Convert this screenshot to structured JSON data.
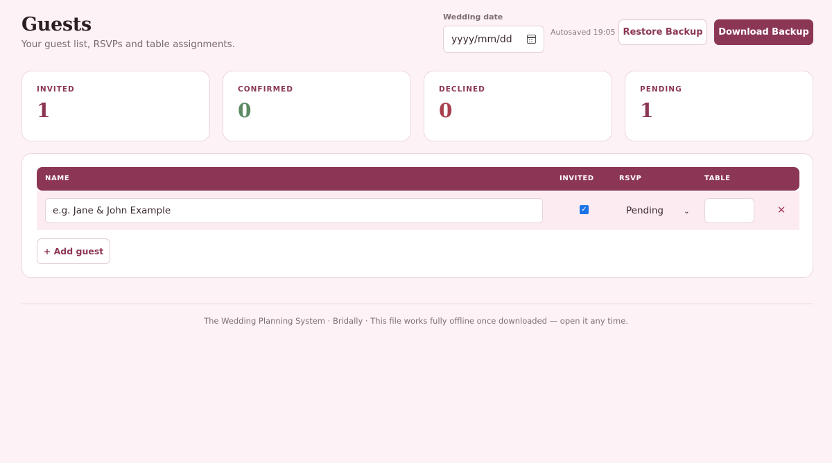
{
  "header": {
    "title": "Guests",
    "subtitle": "Your guest list, RSVPs and table assignments."
  },
  "wedding_date": {
    "label": "Wedding date",
    "placeholder": "yyyy/mm/dd"
  },
  "autosave": "Autosaved 19:05",
  "buttons": {
    "restore": "Restore Backup",
    "download": "Download Backup",
    "add_guest": "+ Add guest",
    "remove": "✕"
  },
  "stats": [
    {
      "label": "INVITED",
      "value": "1",
      "color": "#8c3656"
    },
    {
      "label": "CONFIRMED",
      "value": "0",
      "color": "#5e8a63"
    },
    {
      "label": "DECLINED",
      "value": "0",
      "color": "#a8404f"
    },
    {
      "label": "PENDING",
      "value": "1",
      "color": "#8c3656"
    }
  ],
  "table": {
    "columns": {
      "name": "NAME",
      "invited": "INVITED",
      "rsvp": "RSVP",
      "table": "TABLE"
    },
    "rows": [
      {
        "name_placeholder": "e.g. Jane & John Example",
        "invited": true,
        "rsvp": "Pending",
        "table": ""
      }
    ]
  },
  "footer": "The Wedding Planning System · Bridally · This file works fully offline once downloaded — open it any time.",
  "colors": {
    "accent": "#8c3656",
    "background": "#fdf2f5"
  }
}
